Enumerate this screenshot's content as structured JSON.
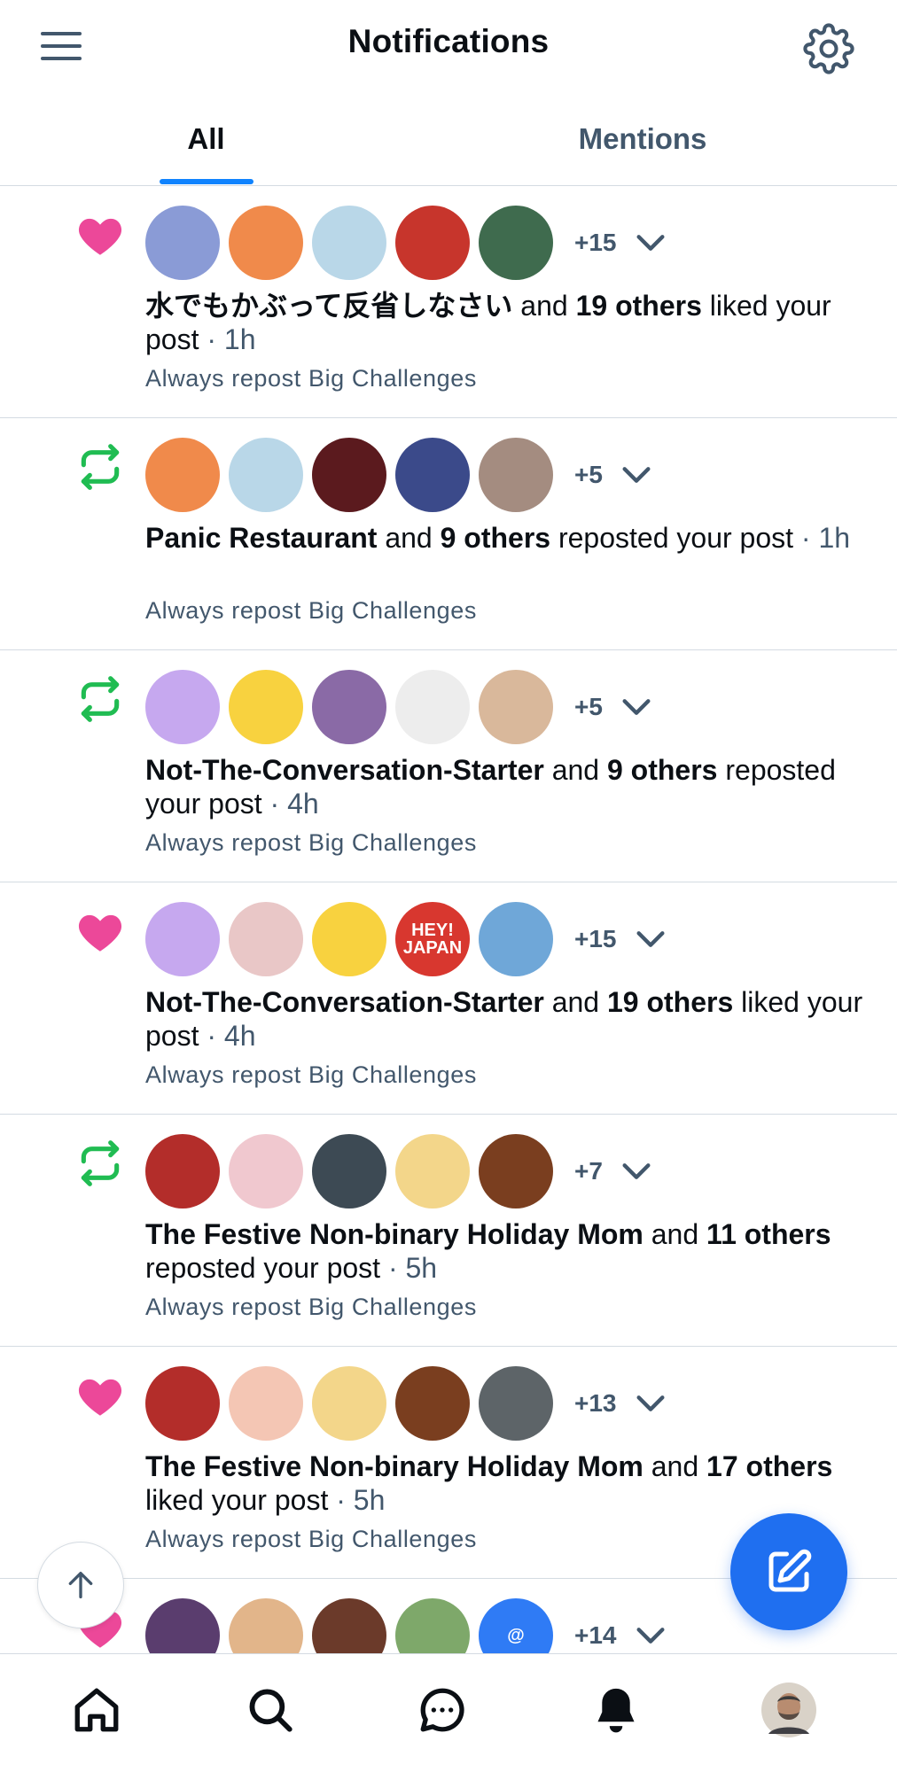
{
  "header": {
    "title": "Notifications",
    "menu_icon": "hamburger-menu-icon",
    "settings_icon": "gear-icon"
  },
  "tabs": [
    {
      "label": "All",
      "active": true
    },
    {
      "label": "Mentions",
      "active": false
    }
  ],
  "colors": {
    "accent": "#1083fe",
    "like": "#ec4899",
    "repost": "#20bc52",
    "muted": "#42576c",
    "divider": "#d4dbe2",
    "compose": "#1f6ff0"
  },
  "notifications": [
    {
      "type": "like",
      "icon": "heart-icon",
      "avatars": [
        "#8a9bd6",
        "#f08a4b",
        "#b9d7e8",
        "#c7352c",
        "#3f6b4e"
      ],
      "more": "+15",
      "actor": "水でもかぶって反省しなさい",
      "joiner": " and ",
      "others": "19 others",
      "action": " liked your post",
      "time": " · 1h",
      "post": "Always repost Big Challenges"
    },
    {
      "type": "repost",
      "icon": "repost-icon",
      "avatars": [
        "#f08a4b",
        "#b9d7e8",
        "#5b1a1e",
        "#3b4a8a",
        "#a48c80"
      ],
      "more": "+5",
      "actor": "Panic Restaurant",
      "joiner": " and ",
      "others": "9 others",
      "action": " reposted your post",
      "time": " · 1h",
      "post": "Always repost Big Challenges"
    },
    {
      "type": "repost",
      "icon": "repost-icon",
      "avatars": [
        "#c6a8ef",
        "#f8d23f",
        "#8a6aa6",
        "#ededed",
        "#d9b89b"
      ],
      "more": "+5",
      "actor": "Not-The-Conversation-Starter",
      "joiner": " and ",
      "others": "9 others",
      "action": " reposted your post",
      "time": " · 4h",
      "post": "Always repost Big Challenges"
    },
    {
      "type": "like",
      "icon": "heart-icon",
      "avatars": [
        "#c6a8ef",
        "#e9c7c7",
        "#f8d23f",
        "#d8372f",
        "#6fa7d8"
      ],
      "avatar_labels": [
        "",
        "",
        "",
        "HEY! JAPAN",
        ""
      ],
      "more": "+15",
      "actor": "Not-The-Conversation-Starter",
      "joiner": " and ",
      "others": "19 others",
      "action": " liked your post",
      "time": " · 4h",
      "post": "Always repost Big Challenges"
    },
    {
      "type": "repost",
      "icon": "repost-icon",
      "avatars": [
        "#b32d2a",
        "#f0c8cf",
        "#3d4a54",
        "#f3d68a",
        "#7a3e1f"
      ],
      "more": "+7",
      "actor": "The Festive Non-binary Holiday Mom",
      "joiner": " and ",
      "others": "11 others",
      "action": " reposted your post",
      "time": " · 5h",
      "post": "Always repost Big Challenges"
    },
    {
      "type": "like",
      "icon": "heart-icon",
      "avatars": [
        "#b32d2a",
        "#f4c6b4",
        "#f3d68a",
        "#7a3e1f",
        "#5d6468"
      ],
      "more": "+13",
      "actor": "The Festive Non-binary Holiday Mom",
      "joiner": " and ",
      "others": "17 others",
      "action": " liked your post",
      "time": " · 5h",
      "post": "Always repost Big Challenges"
    },
    {
      "type": "like",
      "icon": "heart-icon",
      "avatars": [
        "#5a3d6e",
        "#e2b58a",
        "#6b3a2a",
        "#7ea86a",
        "#2f7bf5"
      ],
      "avatar_labels": [
        "",
        "",
        "",
        "",
        "@"
      ],
      "more": "+14",
      "actor": "",
      "joiner": "",
      "others": "",
      "action": "",
      "time": "",
      "post": ""
    }
  ],
  "floating": {
    "scroll_top_icon": "arrow-up-icon",
    "compose_icon": "compose-icon"
  },
  "bottom_nav": [
    {
      "name": "home",
      "icon": "home-icon",
      "active": false
    },
    {
      "name": "search",
      "icon": "search-icon",
      "active": false
    },
    {
      "name": "chat",
      "icon": "chat-icon",
      "active": false
    },
    {
      "name": "notifications",
      "icon": "bell-icon",
      "active": true
    },
    {
      "name": "profile",
      "icon": "profile-avatar",
      "active": false
    }
  ]
}
